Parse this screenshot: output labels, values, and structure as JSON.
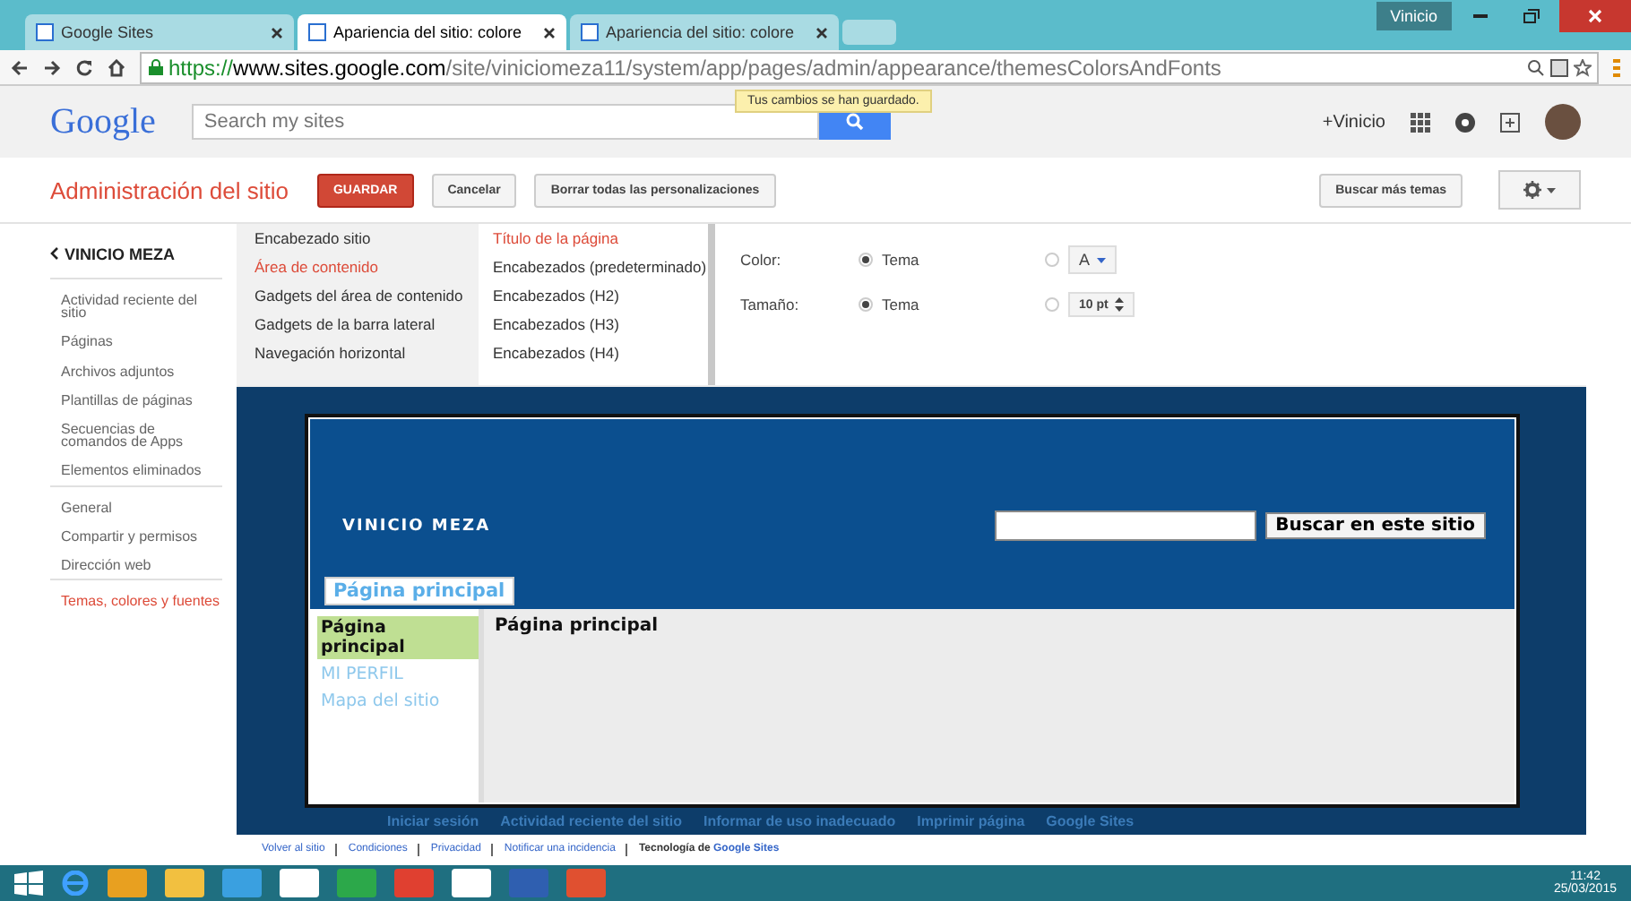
{
  "browser": {
    "tabs": [
      {
        "title": "Google Sites",
        "selected": false
      },
      {
        "title": "Apariencia del sitio: colore",
        "selected": true
      },
      {
        "title": "Apariencia del sitio: colore",
        "selected": false
      }
    ],
    "profile": "Vinicio",
    "url": {
      "scheme": "https://",
      "host": "www.sites.google.com",
      "path": "/site/viniciomeza11/system/app/pages/admin/appearance/themesColorsAndFonts"
    }
  },
  "google_bar": {
    "logo": "Google",
    "search": {
      "placeholder": "Search my sites"
    },
    "toast": "Tus cambios se han guardado.",
    "user": "+Vinicio"
  },
  "admin_bar": {
    "title": "Administración del sitio",
    "buttons": [
      {
        "label": "GUARDAR",
        "kind": "primary"
      },
      {
        "label": "Cancelar",
        "kind": "default"
      },
      {
        "label": "Borrar todas las personalizaciones",
        "kind": "default"
      }
    ],
    "theme_button": "Buscar más temas"
  },
  "sidebar": {
    "back": "VINICIO MEZA",
    "groups": [
      [
        {
          "label": "Actividad reciente del sitio",
          "selected": false
        },
        {
          "label": "Páginas",
          "selected": false
        },
        {
          "label": "Archivos adjuntos",
          "selected": false
        },
        {
          "label": "Plantillas de páginas",
          "selected": false
        },
        {
          "label": "Secuencias de comandos de Apps",
          "selected": false
        },
        {
          "label": "Elementos eliminados",
          "selected": false
        }
      ],
      [
        {
          "label": "General",
          "selected": false
        },
        {
          "label": "Compartir y permisos",
          "selected": false
        },
        {
          "label": "Dirección web",
          "selected": false
        }
      ],
      [
        {
          "label": "Temas, colores y fuentes",
          "selected": true
        }
      ]
    ]
  },
  "editor": {
    "areas": [
      {
        "label": "Encabezado sitio",
        "selected": false
      },
      {
        "label": "Área de contenido",
        "selected": true
      },
      {
        "label": "Gadgets del área de contenido",
        "selected": false
      },
      {
        "label": "Gadgets de la barra lateral",
        "selected": false
      },
      {
        "label": "Navegación horizontal",
        "selected": false
      }
    ],
    "elements": [
      {
        "label": "Título de la página",
        "selected": true
      },
      {
        "label": "Encabezados (predeterminado)",
        "selected": false
      },
      {
        "label": "Encabezados (H2)",
        "selected": false
      },
      {
        "label": "Encabezados (H3)",
        "selected": false
      },
      {
        "label": "Encabezados (H4)",
        "selected": false
      }
    ],
    "properties": [
      {
        "label": "Color:",
        "kind": "color",
        "theme_label": "Tema",
        "theme_selected": true,
        "custom_value": "A"
      },
      {
        "label": "Tamaño:",
        "kind": "size",
        "theme_label": "Tema",
        "theme_selected": true,
        "custom_value": "10 pt"
      }
    ]
  },
  "preview": {
    "site_title": "VINICIO MEZA",
    "search_button": "Buscar en este sitio",
    "nav_tabs": [
      {
        "label": "Página principal",
        "selected": true
      }
    ],
    "sidebar_links": [
      {
        "label": "Página principal",
        "selected": true
      },
      {
        "label": "MI PERFIL",
        "selected": false
      },
      {
        "label": "Mapa del sitio",
        "selected": false
      }
    ],
    "page_title": "Página principal",
    "footer_links": [
      "Iniciar sesión",
      "Actividad reciente del sitio",
      "Informar de uso inadecuado",
      "Imprimir página",
      "Google Sites"
    ]
  },
  "footer": {
    "links": [
      "Volver al sitio",
      "Condiciones",
      "Privacidad",
      "Notificar una incidencia"
    ],
    "powered_by": "Tecnología de **Google Sites**"
  },
  "taskbar": {
    "time": "11:42",
    "date": "25/03/2015"
  }
}
